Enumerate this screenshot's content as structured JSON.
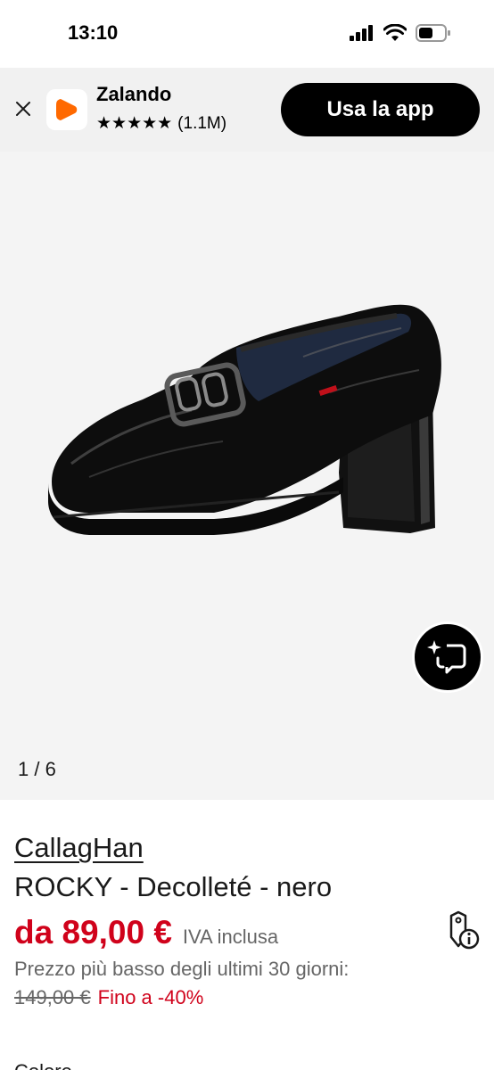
{
  "status_bar": {
    "time": "13:10",
    "icons": [
      "cellular-signal-icon",
      "wifi-icon",
      "battery-icon"
    ]
  },
  "app_banner": {
    "app_name": "Zalando",
    "stars": "★★★★★",
    "rating_count": "(1.1M)",
    "open_app_label": "Usa la app",
    "icons": [
      "close-icon",
      "zalando-logo-icon"
    ],
    "colors": {
      "background": "#f1f1f1",
      "logo": "#ff6900",
      "button": "#000000"
    }
  },
  "gallery": {
    "counter": "1 / 6",
    "image_description_icon": "black-patent-loafer-pump",
    "visual_search_icon": "visual-search-icon"
  },
  "product": {
    "brand": "CallagHan",
    "name": "ROCKY - Decolleté - nero",
    "price": "da 89,00 €",
    "vat_note": "IVA inclusa",
    "lowest_price_note": "Prezzo più basso degli ultimi 30 giorni:",
    "old_price": "149,00 €",
    "discount": "Fino a -40%",
    "price_info_icon": "price-tag-info-icon",
    "next_section_label": "Colore",
    "colors": {
      "price": "#d0021b",
      "muted": "#666666"
    }
  }
}
